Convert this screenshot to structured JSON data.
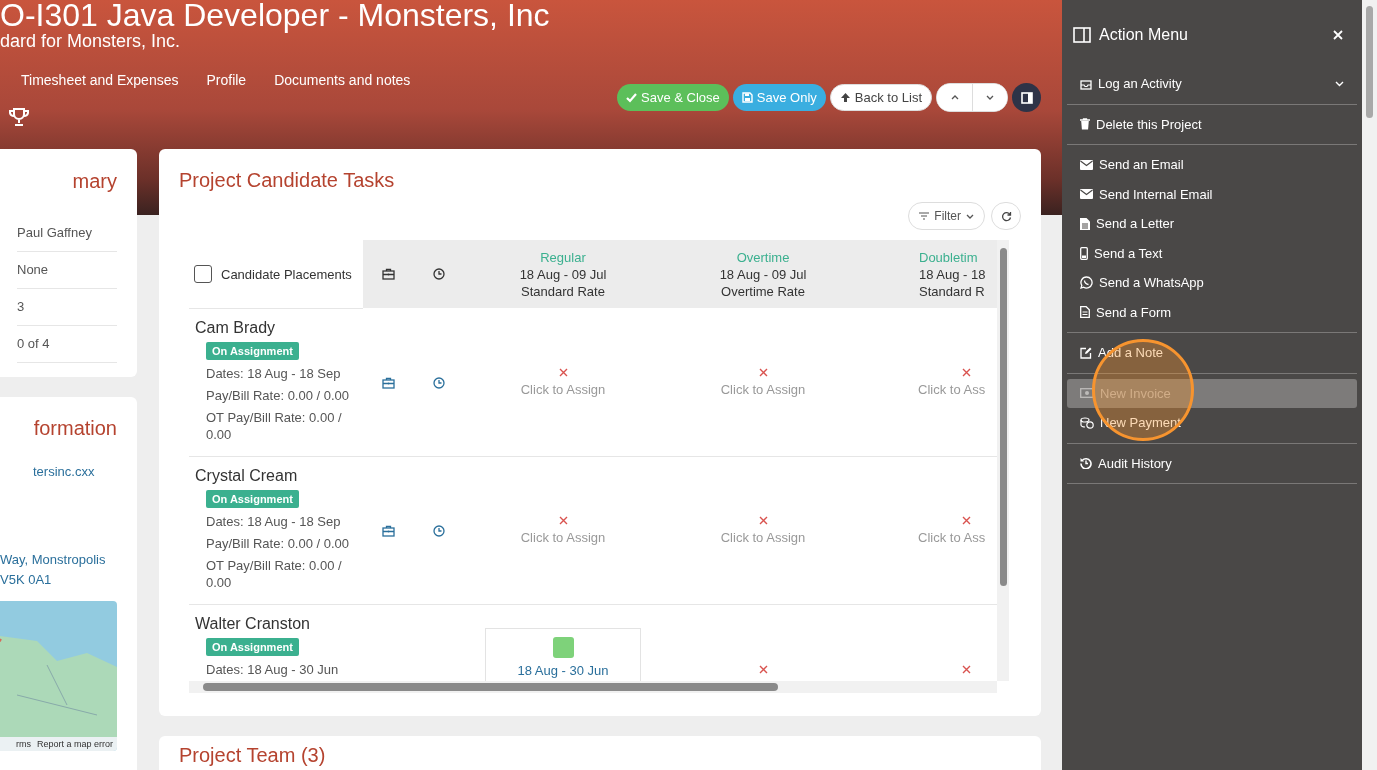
{
  "header": {
    "title": "O-I301 Java Developer - Monsters, Inc",
    "subtitle": "dard for Monsters, Inc.",
    "tabs": [
      {
        "label": "Timesheet and Expenses",
        "selected": false
      },
      {
        "label": "Profile",
        "selected": false
      },
      {
        "label": "Documents and notes",
        "selected": false
      }
    ],
    "buttons": [
      {
        "kind": "save-close",
        "label": "Save & Close"
      },
      {
        "kind": "save",
        "label": "Save Only"
      },
      {
        "kind": "back",
        "label": "Back to List"
      },
      {
        "kind": "prev"
      },
      {
        "kind": "next"
      },
      {
        "kind": "panel"
      }
    ]
  },
  "summary": {
    "title": "mary",
    "values": [
      "Paul Gaffney",
      "None",
      "3",
      "0 of 4"
    ]
  },
  "information": {
    "title": "formation",
    "website": "tersinc.cxx",
    "address": [
      "Way, Monstropolis",
      "V5K 0A1"
    ],
    "map_footer": [
      "rms",
      "Report a map error"
    ]
  },
  "tasks": {
    "title": "Project Candidate Tasks",
    "filter": "Filter",
    "select_all": {
      "checked": false
    },
    "placement_header": "Candidate Placements",
    "rate_columns": [
      {
        "type": "Regular",
        "period": "18 Aug - 09 Jul",
        "rate": "Standard Rate"
      },
      {
        "type": "Overtime",
        "period": "18 Aug - 09 Jul",
        "rate": "Overtime Rate"
      },
      {
        "type": "Doubletim",
        "period": "18 Aug - 18",
        "rate": "Standard R"
      }
    ],
    "rows": [
      {
        "name": "Cam Brady",
        "status": "On Assignment",
        "details": [
          "Dates: 18 Aug - 18 Sep",
          "Pay/Bill Rate: 0.00 / 0.00",
          "OT Pay/Bill Rate: 0.00 / 0.00"
        ],
        "cells": [
          {
            "kind": "unassigned",
            "label": "Click to Assign"
          },
          {
            "kind": "unassigned",
            "label": "Click to Assign"
          },
          {
            "kind": "unassigned",
            "label": "Click to Ass"
          }
        ]
      },
      {
        "name": "Crystal Cream",
        "status": "On Assignment",
        "details": [
          "Dates: 18 Aug - 18 Sep",
          "Pay/Bill Rate: 0.00 / 0.00",
          "OT Pay/Bill Rate: 0.00 / 0.00"
        ],
        "cells": [
          {
            "kind": "unassigned",
            "label": "Click to Assign"
          },
          {
            "kind": "unassigned",
            "label": "Click to Assign"
          },
          {
            "kind": "unassigned",
            "label": "Click to Ass"
          }
        ]
      },
      {
        "name": "Walter Cranston",
        "status": "On Assignment",
        "details": [
          "Dates: 18 Aug - 30 Jun"
        ],
        "cells": [
          {
            "kind": "assigned",
            "label": "18 Aug - 30 Jun"
          },
          {
            "kind": "unassigned"
          },
          {
            "kind": "unassigned"
          }
        ]
      }
    ]
  },
  "team": {
    "title": "Project Team (3)"
  },
  "action_menu": {
    "title": "Action Menu",
    "groups": [
      {
        "items": [
          {
            "kind": "activity",
            "label": "Log an Activity",
            "selected": false
          }
        ]
      },
      {
        "items": [
          {
            "kind": "delete",
            "label": "Delete this Project",
            "selected": false
          }
        ]
      },
      {
        "items": [
          {
            "kind": "email",
            "label": "Send an Email",
            "selected": false
          },
          {
            "kind": "email",
            "label": "Send Internal Email",
            "selected": false
          },
          {
            "kind": "letter",
            "label": "Send a Letter",
            "selected": false
          },
          {
            "kind": "text",
            "label": "Send a Text",
            "selected": false
          },
          {
            "kind": "whatsapp",
            "label": "Send a WhatsApp",
            "selected": false
          },
          {
            "kind": "form",
            "label": "Send a Form",
            "selected": false
          }
        ]
      },
      {
        "items": [
          {
            "kind": "note",
            "label": "Add a Note",
            "selected": false
          }
        ]
      },
      {
        "items": [
          {
            "kind": "invoice",
            "label": "New Invoice",
            "selected": true
          },
          {
            "kind": "payment",
            "label": "New Payment",
            "selected": false
          }
        ]
      },
      {
        "items": [
          {
            "kind": "history",
            "label": "Audit History",
            "selected": false
          }
        ]
      }
    ]
  }
}
